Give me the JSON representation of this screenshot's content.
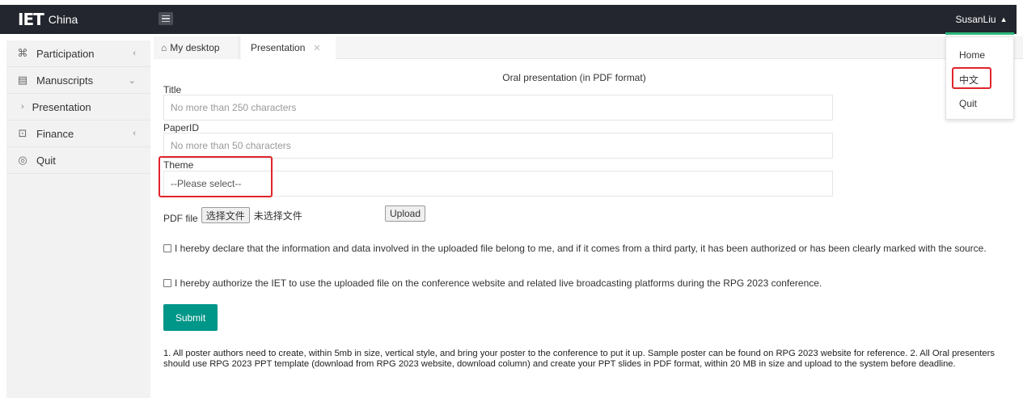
{
  "app": {
    "logo_mark": "IET",
    "logo_text": "China",
    "user_name": "SusanLiu"
  },
  "sidebar": {
    "items": [
      {
        "icon": "cluster-icon",
        "glyph": "⌘",
        "label": "Participation",
        "arrow": "‹"
      },
      {
        "icon": "document-icon",
        "glyph": "▤",
        "label": "Manuscripts",
        "arrow": "⌄"
      },
      {
        "icon": "chevron-right-icon",
        "glyph": "›",
        "label": "Presentation",
        "arrow": ""
      },
      {
        "icon": "wallet-icon",
        "glyph": "⊡",
        "label": "Finance",
        "arrow": "‹"
      },
      {
        "icon": "power-icon",
        "glyph": "◎",
        "label": "Quit",
        "arrow": ""
      }
    ]
  },
  "tabs": [
    {
      "label": "My desktop",
      "icon": "home-icon"
    },
    {
      "label": "Presentation",
      "icon": "close-icon"
    }
  ],
  "user_dropdown": {
    "items": [
      "Home",
      "中文",
      "Quit"
    ]
  },
  "form": {
    "heading": "Oral presentation (in PDF format)",
    "title_label": "Title",
    "title_placeholder": "No more than 250 characters",
    "paperid_label": "PaperID",
    "paperid_placeholder": "No more than 50 characters",
    "theme_label": "Theme",
    "theme_selected": "--Please select--",
    "pdf_label": "PDF file",
    "file_button": "选择文件",
    "file_status": "未选择文件",
    "upload_button": "Upload",
    "declaration_1": "I hereby declare that the information and data involved in the uploaded file belong to me, and if it comes from a third party, it has been authorized or has been clearly marked with the source.",
    "declaration_2": "I hereby authorize the IET to use the uploaded file on the conference website and related live broadcasting platforms during the RPG 2023 conference.",
    "submit_button": "Submit",
    "notes": "1. All poster authors need to create, within 5mb in size, vertical style, and bring your poster to the conference to put it up. Sample poster can be found on RPG 2023 website for reference. 2. All Oral presenters should use RPG 2023 PPT template (download from RPG 2023 website, download column) and create your PPT slides in PDF format, within 20 MB in size and upload to the system before deadline."
  },
  "colors": {
    "header_bg": "#23262e",
    "accent_teal": "#009688",
    "highlight_red": "#e0242b",
    "active_underline": "#2db87d"
  }
}
